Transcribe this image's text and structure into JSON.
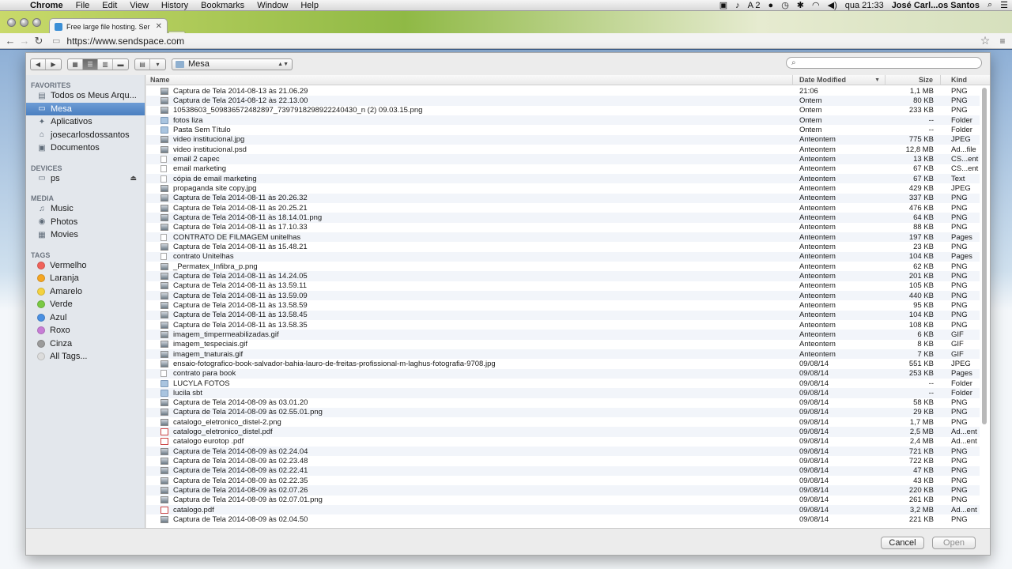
{
  "menubar": {
    "app": "Chrome",
    "items": [
      "File",
      "Edit",
      "View",
      "History",
      "Bookmarks",
      "Window",
      "Help"
    ],
    "status": {
      "notif": "2",
      "clock": "qua 21:33",
      "user": "José Carl...os Santos"
    }
  },
  "browser": {
    "tab_title": "Free large file hosting. Ser",
    "url": "https://www.sendspace.com"
  },
  "dialog": {
    "location": "Mesa",
    "search_placeholder": "",
    "columns": {
      "name": "Name",
      "date": "Date Modified",
      "size": "Size",
      "kind": "Kind"
    },
    "cancel_label": "Cancel",
    "open_label": "Open"
  },
  "sidebar": {
    "favorites_title": "FAVORITES",
    "favorites": [
      {
        "label": "Todos os Meus Arqu...",
        "icon": "all-files-icon"
      },
      {
        "label": "Mesa",
        "icon": "desktop-icon"
      },
      {
        "label": "Aplicativos",
        "icon": "applications-icon"
      },
      {
        "label": "josecarlosdossantos",
        "icon": "home-icon"
      },
      {
        "label": "Documentos",
        "icon": "documents-icon"
      }
    ],
    "devices_title": "DEVICES",
    "devices": [
      {
        "label": "ps",
        "icon": "disk-icon"
      }
    ],
    "media_title": "MEDIA",
    "media": [
      {
        "label": "Music",
        "icon": "music-icon"
      },
      {
        "label": "Photos",
        "icon": "camera-icon"
      },
      {
        "label": "Movies",
        "icon": "film-icon"
      }
    ],
    "tags_title": "TAGS",
    "tags": [
      {
        "label": "Vermelho",
        "color": "#f0625a"
      },
      {
        "label": "Laranja",
        "color": "#f5a623"
      },
      {
        "label": "Amarelo",
        "color": "#f4d23f"
      },
      {
        "label": "Verde",
        "color": "#7ac943"
      },
      {
        "label": "Azul",
        "color": "#4a90e2"
      },
      {
        "label": "Roxo",
        "color": "#c77dd6"
      },
      {
        "label": "Cinza",
        "color": "#9b9b9b"
      },
      {
        "label": "All Tags...",
        "color": "#dcdcdc"
      }
    ]
  },
  "files": [
    {
      "name": "Captura de Tela 2014-08-13 às 21.06.29",
      "date": "21:06",
      "size": "1,1 MB",
      "kind": "PNG",
      "type": "img"
    },
    {
      "name": "Captura de Tela 2014-08-12 às 22.13.00",
      "date": "Ontem",
      "size": "80 KB",
      "kind": "PNG",
      "type": "img"
    },
    {
      "name": "10538603_509836572482897_7397918298922240430_n (2) 09.03.15.png",
      "date": "Ontem",
      "size": "233 KB",
      "kind": "PNG",
      "type": "img"
    },
    {
      "name": "fotos liza",
      "date": "Ontem",
      "size": "--",
      "kind": "Folder",
      "type": "folder"
    },
    {
      "name": "Pasta Sem Título",
      "date": "Ontem",
      "size": "--",
      "kind": "Folder",
      "type": "folder"
    },
    {
      "name": "video institucional.jpg",
      "date": "Anteontem",
      "size": "775 KB",
      "kind": "JPEG",
      "type": "img"
    },
    {
      "name": "video institucional.psd",
      "date": "Anteontem",
      "size": "12,8 MB",
      "kind": "Ad...file",
      "type": "img"
    },
    {
      "name": "email 2 capec",
      "date": "Anteontem",
      "size": "13 KB",
      "kind": "CS...ent",
      "type": "doc"
    },
    {
      "name": "email marketing",
      "date": "Anteontem",
      "size": "67 KB",
      "kind": "CS...ent",
      "type": "doc"
    },
    {
      "name": "cópia de email marketing",
      "date": "Anteontem",
      "size": "67 KB",
      "kind": "Text",
      "type": "doc"
    },
    {
      "name": "propaganda site copy.jpg",
      "date": "Anteontem",
      "size": "429 KB",
      "kind": "JPEG",
      "type": "img"
    },
    {
      "name": "Captura de Tela 2014-08-11 às 20.26.32",
      "date": "Anteontem",
      "size": "337 KB",
      "kind": "PNG",
      "type": "img"
    },
    {
      "name": "Captura de Tela 2014-08-11 às 20.25.21",
      "date": "Anteontem",
      "size": "476 KB",
      "kind": "PNG",
      "type": "img"
    },
    {
      "name": "Captura de Tela 2014-08-11 às 18.14.01.png",
      "date": "Anteontem",
      "size": "64 KB",
      "kind": "PNG",
      "type": "img"
    },
    {
      "name": "Captura de Tela 2014-08-11 às 17.10.33",
      "date": "Anteontem",
      "size": "88 KB",
      "kind": "PNG",
      "type": "img"
    },
    {
      "name": "CONTRATO DE FILMAGEM unitelhas",
      "date": "Anteontem",
      "size": "197 KB",
      "kind": "Pages",
      "type": "doc"
    },
    {
      "name": "Captura de Tela 2014-08-11 às 15.48.21",
      "date": "Anteontem",
      "size": "23 KB",
      "kind": "PNG",
      "type": "img"
    },
    {
      "name": "contrato Unitelhas",
      "date": "Anteontem",
      "size": "104 KB",
      "kind": "Pages",
      "type": "doc"
    },
    {
      "name": "_Permatex_Infibra_p.png",
      "date": "Anteontem",
      "size": "62 KB",
      "kind": "PNG",
      "type": "img"
    },
    {
      "name": "Captura de Tela 2014-08-11 às 14.24.05",
      "date": "Anteontem",
      "size": "201 KB",
      "kind": "PNG",
      "type": "img"
    },
    {
      "name": "Captura de Tela 2014-08-11 às 13.59.11",
      "date": "Anteontem",
      "size": "105 KB",
      "kind": "PNG",
      "type": "img"
    },
    {
      "name": "Captura de Tela 2014-08-11 às 13.59.09",
      "date": "Anteontem",
      "size": "440 KB",
      "kind": "PNG",
      "type": "img"
    },
    {
      "name": "Captura de Tela 2014-08-11 às 13.58.59",
      "date": "Anteontem",
      "size": "95 KB",
      "kind": "PNG",
      "type": "img"
    },
    {
      "name": "Captura de Tela 2014-08-11 às 13.58.45",
      "date": "Anteontem",
      "size": "104 KB",
      "kind": "PNG",
      "type": "img"
    },
    {
      "name": "Captura de Tela 2014-08-11 às 13.58.35",
      "date": "Anteontem",
      "size": "108 KB",
      "kind": "PNG",
      "type": "img"
    },
    {
      "name": "imagem_timpermeabilizadas.gif",
      "date": "Anteontem",
      "size": "6 KB",
      "kind": "GIF",
      "type": "img"
    },
    {
      "name": "imagem_tespeciais.gif",
      "date": "Anteontem",
      "size": "8 KB",
      "kind": "GIF",
      "type": "img"
    },
    {
      "name": "imagem_tnaturais.gif",
      "date": "Anteontem",
      "size": "7 KB",
      "kind": "GIF",
      "type": "img"
    },
    {
      "name": "ensaio-fotografico-book-salvador-bahia-lauro-de-freitas-profissional-m-laghus-fotografia-9708.jpg",
      "date": "09/08/14",
      "size": "551 KB",
      "kind": "JPEG",
      "type": "img"
    },
    {
      "name": "contrato para book",
      "date": "09/08/14",
      "size": "253 KB",
      "kind": "Pages",
      "type": "doc"
    },
    {
      "name": "LUCYLA FOTOS",
      "date": "09/08/14",
      "size": "--",
      "kind": "Folder",
      "type": "folder"
    },
    {
      "name": "lucila sbt",
      "date": "09/08/14",
      "size": "--",
      "kind": "Folder",
      "type": "folder"
    },
    {
      "name": "Captura de Tela 2014-08-09 às 03.01.20",
      "date": "09/08/14",
      "size": "58 KB",
      "kind": "PNG",
      "type": "img"
    },
    {
      "name": "Captura de Tela 2014-08-09 às 02.55.01.png",
      "date": "09/08/14",
      "size": "29 KB",
      "kind": "PNG",
      "type": "img"
    },
    {
      "name": "catalogo_eletronico_distel-2.png",
      "date": "09/08/14",
      "size": "1,7 MB",
      "kind": "PNG",
      "type": "img"
    },
    {
      "name": "catalogo_eletronico_distel.pdf",
      "date": "09/08/14",
      "size": "2,5 MB",
      "kind": "Ad...ent",
      "type": "pdf"
    },
    {
      "name": "catalogo eurotop .pdf",
      "date": "09/08/14",
      "size": "2,4 MB",
      "kind": "Ad...ent",
      "type": "pdf"
    },
    {
      "name": "Captura de Tela 2014-08-09 às 02.24.04",
      "date": "09/08/14",
      "size": "721 KB",
      "kind": "PNG",
      "type": "img"
    },
    {
      "name": "Captura de Tela 2014-08-09 às 02.23.48",
      "date": "09/08/14",
      "size": "722 KB",
      "kind": "PNG",
      "type": "img"
    },
    {
      "name": "Captura de Tela 2014-08-09 às 02.22.41",
      "date": "09/08/14",
      "size": "47 KB",
      "kind": "PNG",
      "type": "img"
    },
    {
      "name": "Captura de Tela 2014-08-09 às 02.22.35",
      "date": "09/08/14",
      "size": "43 KB",
      "kind": "PNG",
      "type": "img"
    },
    {
      "name": "Captura de Tela 2014-08-09 às 02.07.26",
      "date": "09/08/14",
      "size": "220 KB",
      "kind": "PNG",
      "type": "img"
    },
    {
      "name": "Captura de Tela 2014-08-09 às 02.07.01.png",
      "date": "09/08/14",
      "size": "261 KB",
      "kind": "PNG",
      "type": "img"
    },
    {
      "name": "catalogo.pdf",
      "date": "09/08/14",
      "size": "3,2 MB",
      "kind": "Ad...ent",
      "type": "pdf"
    },
    {
      "name": "Captura de Tela 2014-08-09 às 02.04.50",
      "date": "09/08/14",
      "size": "221 KB",
      "kind": "PNG",
      "type": "img"
    }
  ]
}
